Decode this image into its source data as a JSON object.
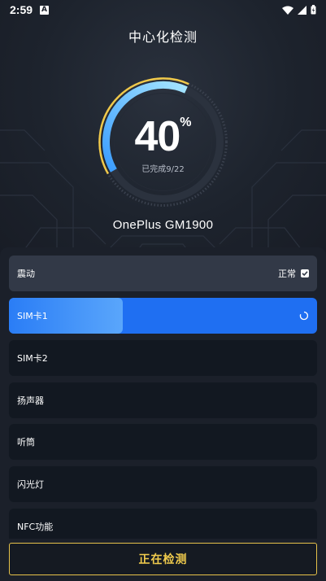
{
  "status_bar": {
    "time": "2:59",
    "app_icon_letter": "A",
    "icons": [
      "wifi-icon",
      "signal-icon",
      "battery-icon"
    ]
  },
  "header": {
    "title": "中心化检测"
  },
  "gauge": {
    "percent": "40",
    "percent_sign": "%",
    "progress_text": "已完成9/22",
    "progress_fraction": 0.4,
    "colors": {
      "arc_start": "#3fa7ff",
      "arc_end": "#9fe1ff",
      "outer_accent": "#f0c94a"
    }
  },
  "device": {
    "name": "OnePlus GM1900"
  },
  "tests": {
    "items": [
      {
        "label": "震动",
        "status": "正常",
        "state": "done"
      },
      {
        "label": "SIM卡1",
        "status": "",
        "state": "active",
        "progress": 0.37
      },
      {
        "label": "SIM卡2",
        "status": "",
        "state": "pending"
      },
      {
        "label": "扬声器",
        "status": "",
        "state": "pending"
      },
      {
        "label": "听筒",
        "status": "",
        "state": "pending"
      },
      {
        "label": "闪光灯",
        "status": "",
        "state": "pending"
      },
      {
        "label": "NFC功能",
        "status": "",
        "state": "pending"
      }
    ]
  },
  "action": {
    "button_label": "正在检测"
  },
  "colors": {
    "background": "#1a1f29",
    "item_bg": "#121821",
    "item_done_bg": "#323947",
    "item_active_bg": "#1f6ff2",
    "button_accent": "#f1cc4d"
  }
}
